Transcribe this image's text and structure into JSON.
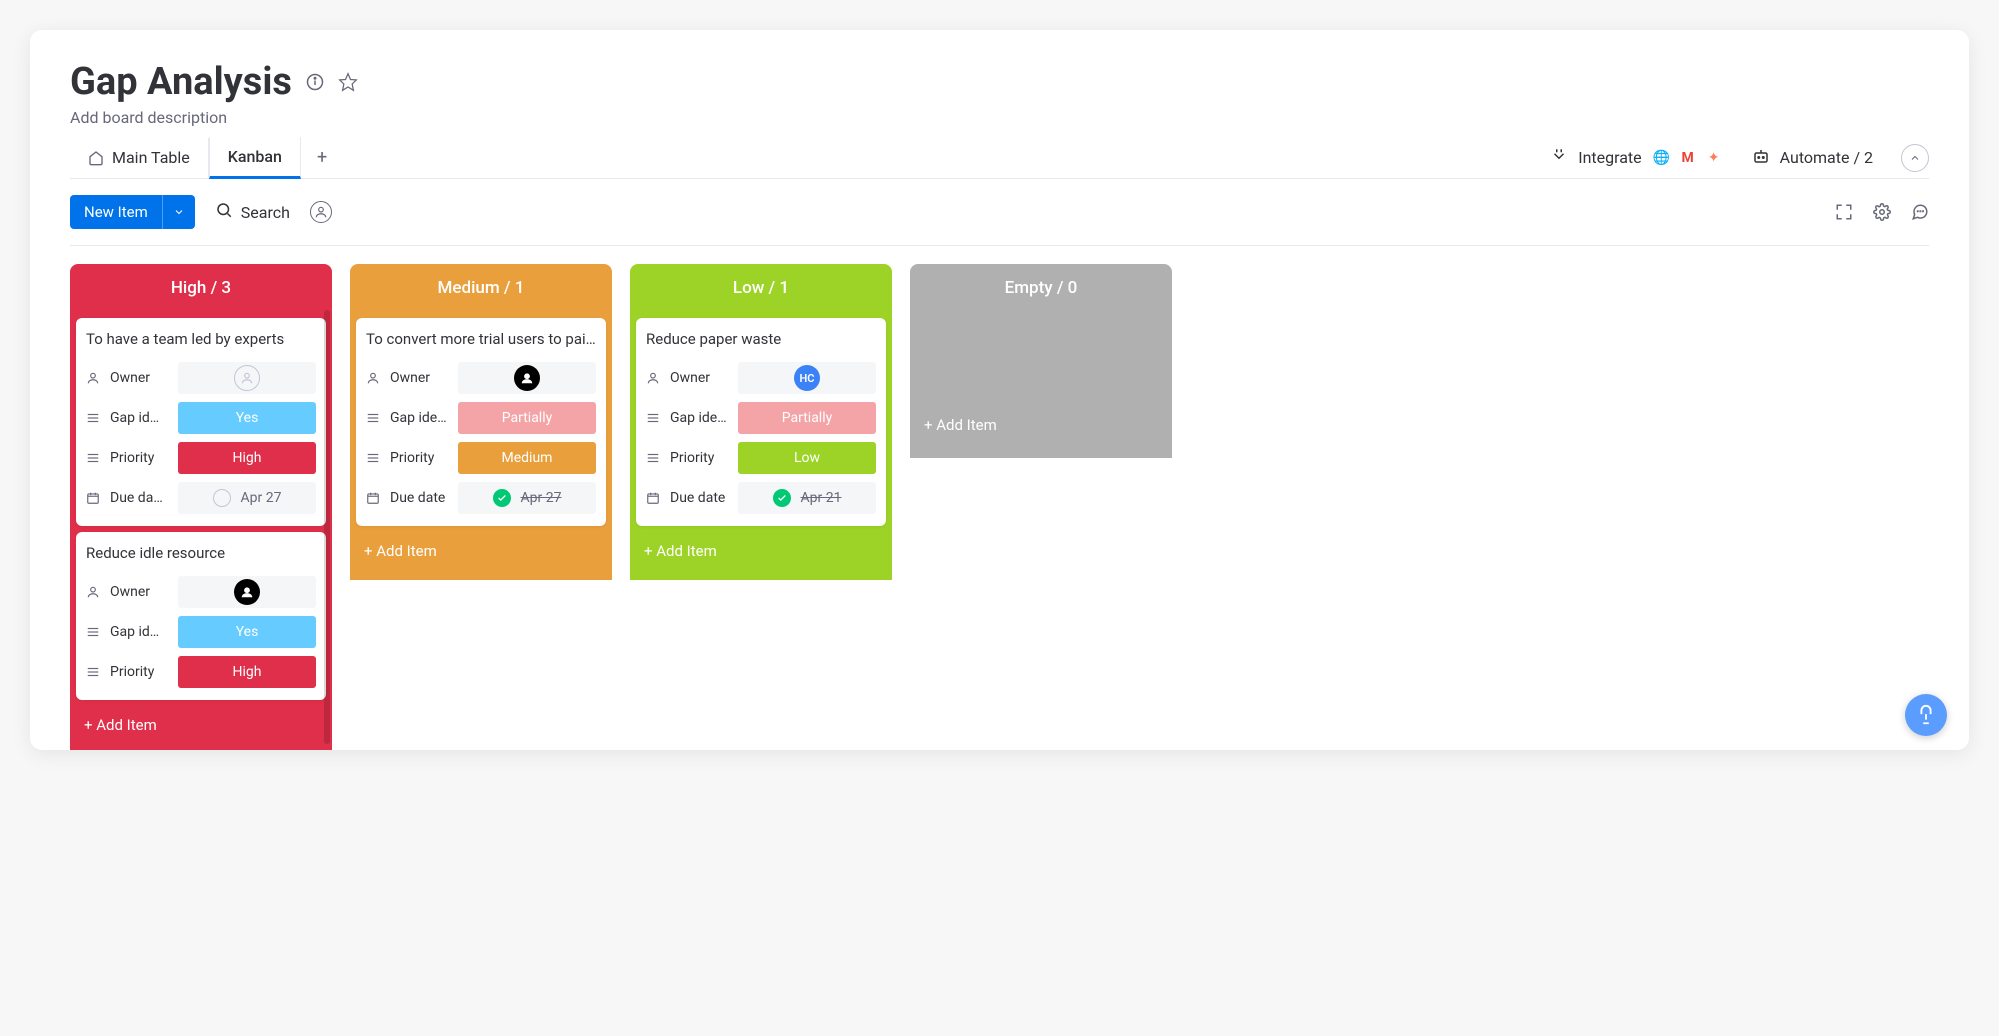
{
  "header": {
    "title": "Gap Analysis",
    "description_placeholder": "Add board description"
  },
  "tabs": {
    "main": "Main Table",
    "kanban": "Kanban"
  },
  "actions": {
    "integrate": "Integrate",
    "automate": "Automate / 2"
  },
  "toolbar": {
    "new_item": "New Item",
    "search": "Search"
  },
  "columns": {
    "high": {
      "label": "High",
      "count": "3",
      "header": "High / 3"
    },
    "medium": {
      "label": "Medium",
      "count": "1",
      "header": "Medium / 1"
    },
    "low": {
      "label": "Low",
      "count": "1",
      "header": "Low / 1"
    },
    "empty": {
      "label": "Empty",
      "count": "0",
      "header": "Empty / 0"
    }
  },
  "field_labels": {
    "owner": "Owner",
    "gap": "Gap id…",
    "gap2": "Gap ide…",
    "priority": "Priority",
    "due": "Due da…",
    "due_full": "Due date"
  },
  "cards": {
    "c1": {
      "title": "To have a team led by experts",
      "gap": "Yes",
      "priority": "High",
      "due": "Apr 27"
    },
    "c2": {
      "title": "Reduce idle resource",
      "gap": "Yes",
      "priority": "High"
    },
    "c3": {
      "title": "To convert more trial users to paid/…",
      "gap": "Partially",
      "priority": "Medium",
      "due": "Apr 27"
    },
    "c4": {
      "title": "Reduce paper waste",
      "gap": "Partially",
      "priority": "Low",
      "due": "Apr 21",
      "owner_initials": "HC"
    }
  },
  "add_item": "+ Add Item"
}
